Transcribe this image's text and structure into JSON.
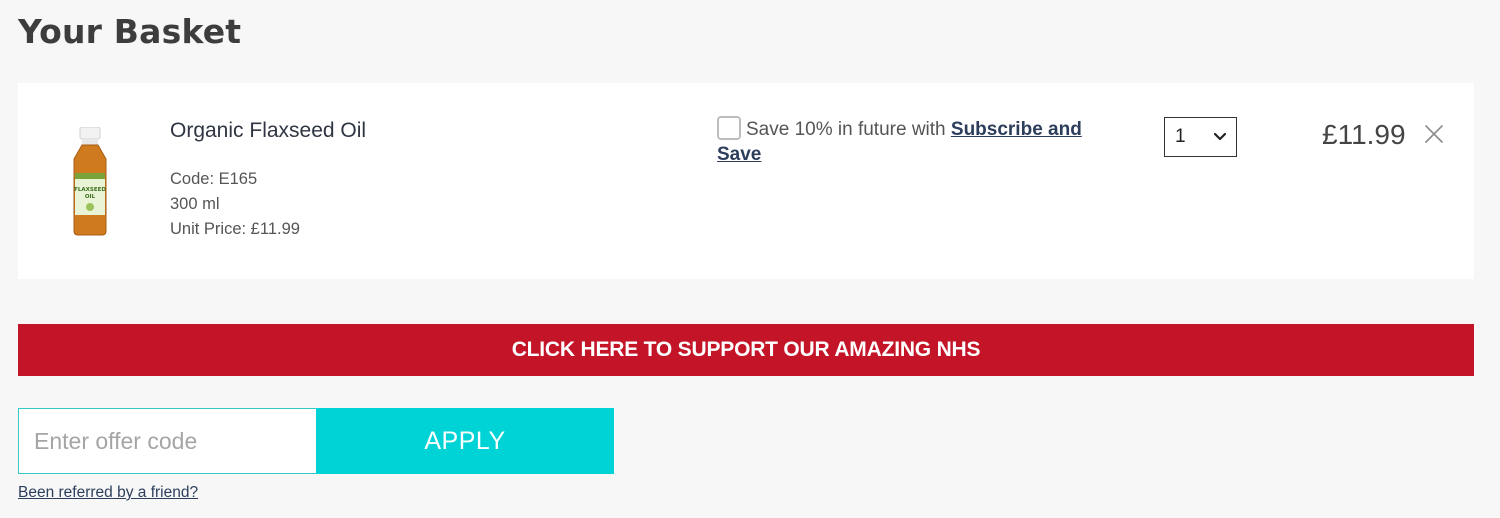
{
  "page": {
    "title": "Your Basket"
  },
  "basket": {
    "item": {
      "name": "Organic Flaxseed Oil",
      "code": "Code: E165",
      "size": "300 ml",
      "unit_price": "Unit Price: £11.99",
      "image_label": "FLAXSEED OIL",
      "subscribe_text": "Save 10% in future with ",
      "subscribe_link": "Subscribe and Save",
      "quantity": "1",
      "line_price": "£11.99",
      "remove_icon": "close-icon"
    }
  },
  "banner": {
    "text": "CLICK HERE TO SUPPORT OUR AMAZING NHS",
    "color": "#c41428"
  },
  "offer": {
    "placeholder": "Enter offer code",
    "apply_label": "APPLY",
    "accent": "#00d3d6"
  },
  "referral": {
    "link_text": "Been referred by a friend?"
  }
}
